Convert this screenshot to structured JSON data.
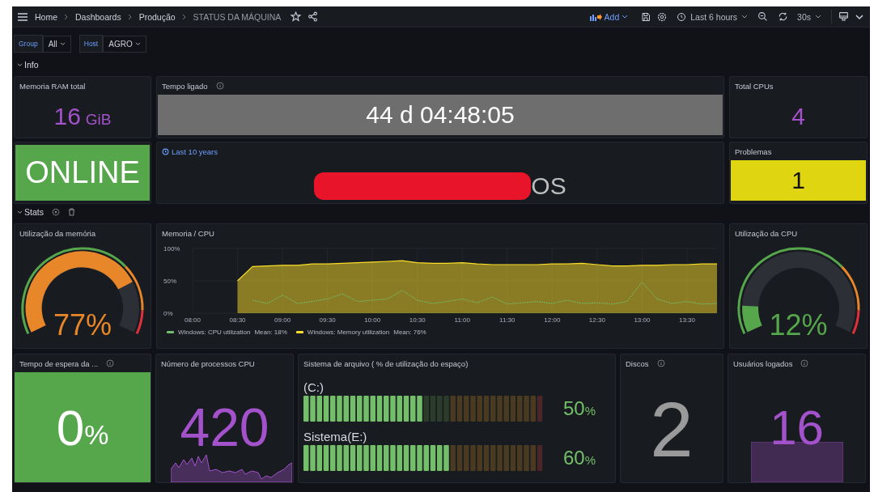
{
  "topbar": {
    "breadcrumbs": [
      "Home",
      "Dashboards",
      "Produção",
      "STATUS DA MÁQUINA"
    ],
    "add_label": "Add",
    "time_range": "Last 6 hours",
    "refresh_interval": "30s"
  },
  "variables": [
    {
      "label": "Group",
      "value": "All"
    },
    {
      "label": "Host",
      "value": "AGRO"
    }
  ],
  "sections": [
    {
      "title": "Info",
      "expanded": true,
      "show_tools": false
    },
    {
      "title": "Stats",
      "expanded": true,
      "show_tools": true
    }
  ],
  "info_panels": [
    {
      "title": "Memoria RAM total",
      "value": "16",
      "unit": "GiB",
      "kind": "value",
      "color": "#a352cc"
    },
    {
      "title": "Tempo ligado",
      "info": true,
      "value": "44 d 04:48:05",
      "kind": "background",
      "color": "#6e6e6e"
    },
    {
      "title": "Total CPUs",
      "value": "4",
      "kind": "value",
      "color": "#a352cc"
    },
    {
      "value": "ONLINE",
      "kind": "background",
      "color": "#56a64b"
    },
    {
      "time_note": "Last 10 years",
      "value": "OS",
      "redacted": true,
      "kind": "value",
      "color": "#bdbdbd"
    },
    {
      "title": "Problemas",
      "value": "1",
      "kind": "background",
      "color": "#e0d511"
    }
  ],
  "memory_gauge": {
    "title": "Utilização da memória",
    "value": "77",
    "unit": "%",
    "color": "#e8862a"
  },
  "chart_panel": {
    "title": "Memoria / CPU",
    "legend_means": [
      "Mean: 18%",
      "Mean: 76%"
    ],
    "chart_data": {
      "type": "line",
      "grid": true,
      "legend": "bottom",
      "categories": [
        "08:00",
        null,
        null,
        "08:30",
        null,
        null,
        "09:00",
        null,
        null,
        "09:30",
        null,
        null,
        "10:00",
        null,
        null,
        "10:30",
        null,
        null,
        "11:00",
        null,
        null,
        "11:30",
        null,
        null,
        "12:00",
        null,
        null,
        "12:30",
        null,
        null,
        "13:00",
        null,
        null,
        "13:30",
        null,
        null
      ],
      "ylim": [
        0,
        100
      ],
      "yticks": [
        {
          "value": 0,
          "label": "0%"
        },
        {
          "value": 50,
          "label": "50%"
        },
        {
          "value": 100,
          "label": "100%"
        }
      ],
      "series": [
        {
          "name": "Windows: CPU utilization",
          "color": "#73bf69",
          "line_style": "dashed",
          "values": [
            null,
            null,
            null,
            null,
            20,
            15,
            28,
            15,
            18,
            22,
            30,
            18,
            20,
            22,
            35,
            20,
            15,
            18,
            22,
            16,
            25,
            14,
            16,
            18,
            15,
            20,
            15,
            16,
            14,
            18,
            48,
            22,
            15,
            18,
            14,
            15
          ]
        },
        {
          "name": "Windows: Memory utilization",
          "color": "#fade2a",
          "type": "area",
          "line_style": "solid",
          "values": [
            null,
            null,
            null,
            50,
            72,
            73,
            74,
            74,
            76,
            76,
            77,
            78,
            79,
            80,
            81,
            78,
            77,
            77,
            78,
            76,
            75,
            75,
            75,
            75,
            76,
            76,
            77,
            75,
            73,
            73,
            74,
            74,
            75,
            75,
            76,
            76
          ]
        }
      ]
    }
  },
  "cpu_gauge": {
    "title": "Utilização da CPU",
    "value": "12",
    "unit": "%",
    "color": "#56a64b"
  },
  "wait_panel": {
    "title": "Tempo de espera da ...",
    "info": true,
    "value": "0",
    "unit": "%",
    "color": "#56a64b"
  },
  "processes_panel": {
    "title": "Número de processos CPU",
    "value": "420",
    "color": "#a352cc"
  },
  "filesystem_panel": {
    "title": "Sistema de arquivo ( % de utilização do espaço)",
    "drives": [
      {
        "name": "(C:)",
        "level": 0.5,
        "value": "50",
        "unit": "%"
      },
      {
        "name": "Sistema(E:)",
        "level": 0.6,
        "value": "60",
        "unit": "%"
      }
    ]
  },
  "disks_panel": {
    "title": "Discos",
    "info": true,
    "value": "2",
    "color": "#9a9a9a"
  },
  "users_panel": {
    "title": "Usuários logados",
    "info": true,
    "value": "16",
    "color": "#a352cc"
  }
}
